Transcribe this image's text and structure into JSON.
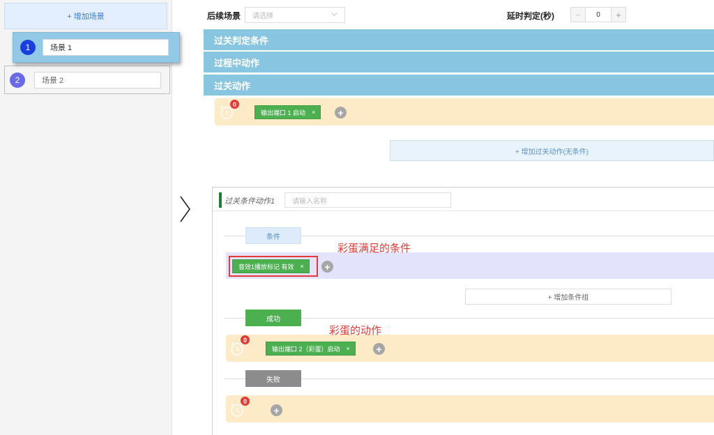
{
  "sidebar": {
    "add_scene_label": "+ 增加场景",
    "scenes": [
      {
        "number": "1",
        "name": "场景 1"
      },
      {
        "number": "2",
        "name": "场景 2"
      }
    ]
  },
  "topbar": {
    "follow_label": "后续场景",
    "follow_placeholder": "请选择",
    "delay_label": "延时判定(秒)",
    "stepper_minus": "−",
    "stepper_value": "0",
    "stepper_plus": "+"
  },
  "sections": {
    "pass_condition": "过关判定条件",
    "in_process_action": "过程中动作",
    "pass_action": "过关动作"
  },
  "pass_action_row": {
    "badge": "0",
    "tag_label": "输出端口 1 启动",
    "tag_close": "×",
    "plus": "+"
  },
  "add_unconditional_action": "+ 增加过关动作(无条件)",
  "condition_action": {
    "title": "过关条件动作1",
    "name_placeholder": "请输入名称",
    "condition_pill": "条件",
    "condition_tag_label": "音效1播放标记 有效",
    "condition_tag_close": "×",
    "condition_plus": "+",
    "add_condition_group": "+ 增加条件组",
    "success_pill": "成功",
    "success_badge": "0",
    "success_tag_label": "输出端口 2（彩蛋）启动",
    "success_tag_close": "×",
    "success_plus": "+",
    "fail_pill": "失败",
    "fail_badge": "0",
    "fail_plus": "+"
  },
  "annotations": {
    "condition_note": "彩蛋满足的条件",
    "action_note": "彩蛋的动作"
  },
  "colors": {
    "section_header": "#87c5e1",
    "action_row": "#fdebc8",
    "condition_row": "#e3e3fb",
    "tag_green": "#4caf50",
    "annotation_red": "#e53935",
    "scene_active": "#91c9e6"
  }
}
